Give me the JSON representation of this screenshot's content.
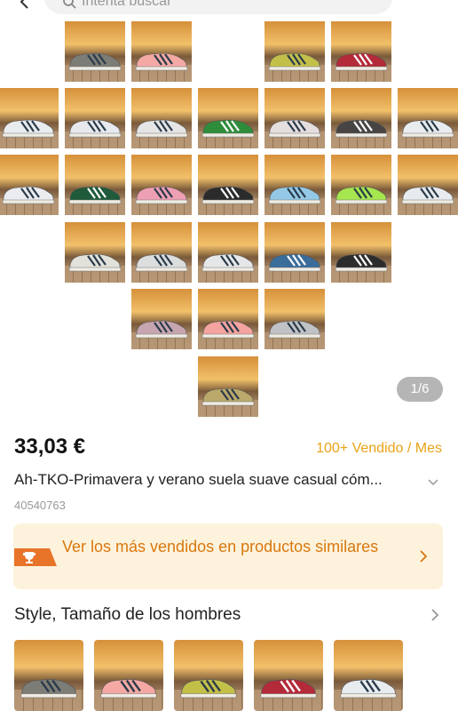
{
  "header": {
    "search_placeholder": "Intenta buscar"
  },
  "gallery": {
    "page_indicator": "1/6",
    "shoe_colors": [
      "#7d7d77",
      "#f4a9a4",
      "#c3c04a",
      "#b42a39",
      "#e8ecef",
      "#e7e9ee",
      "#e5e5e5",
      "#2f8c3b",
      "#e5dede",
      "#484444",
      "#e9ecee",
      "#eaecef",
      "#1f5a3b",
      "#ee9fb4",
      "#2b2b2b",
      "#93c9e6",
      "#a6e64f",
      "#e8ebee",
      "#e2e2da",
      "#dcdede",
      "#e5e7e9",
      "#3b6d9a",
      "#2c2c2c",
      "#c7a5b0",
      "#f4a39e",
      "#c0c2c5",
      "#bba86b",
      "#2c8a6b"
    ]
  },
  "product": {
    "price": "33,03 €",
    "sold": "100+ Vendido / Mes",
    "title": "Ah-TKO-Primavera y verano suela suave casual cóm...",
    "id": "40540763"
  },
  "banner": {
    "text": "Ver los más vendidos en productos similares"
  },
  "variants": {
    "title": "Style, Tamaño de los hombres",
    "colors": [
      "#7d7d77",
      "#f4a9a4",
      "#c3c04a",
      "#b42a39",
      "#e8ecef"
    ]
  },
  "colors": {
    "accent_orange": "#d9770e",
    "sold_yellow": "#e8a317",
    "banner_bg": "#fdf3dc"
  }
}
